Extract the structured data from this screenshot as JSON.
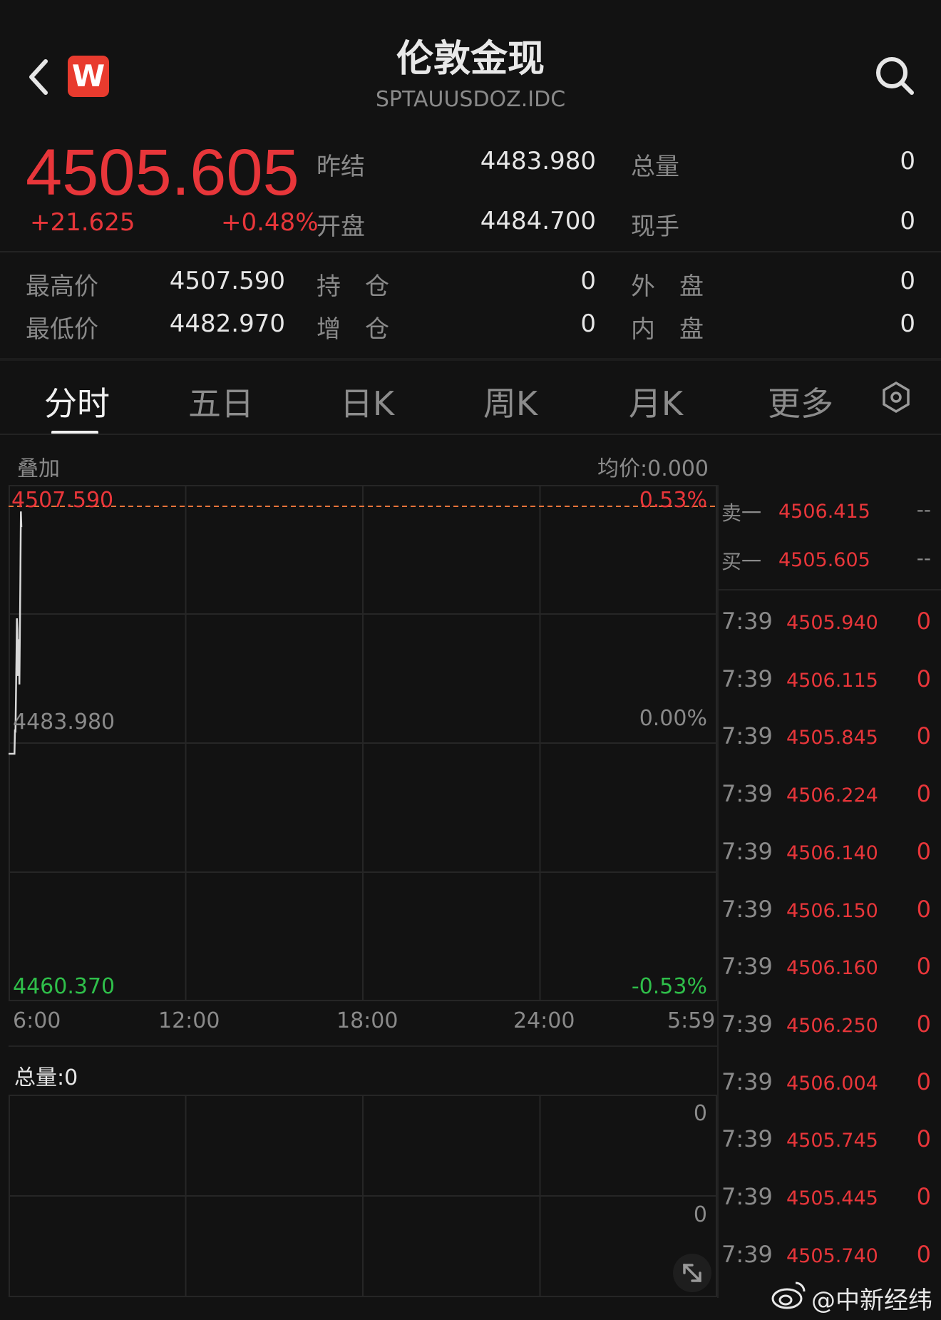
{
  "header": {
    "title": "伦敦金现",
    "code": "SPTAUUSDOZ.IDC",
    "logo_letter": "W",
    "back_icon": "chevron-left-icon",
    "search_icon": "search-icon"
  },
  "quote": {
    "last": "4505.605",
    "change": "+21.625",
    "change_pct": "+0.48%",
    "prev_settle_label": "昨结",
    "prev_settle": "4483.980",
    "open_label": "开盘",
    "open": "4484.700",
    "total_vol_label": "总量",
    "total_vol": "0",
    "cur_hand_label": "现手",
    "cur_hand": "0",
    "high_label": "最高价",
    "high": "4507.590",
    "low_label": "最低价",
    "low": "4482.970",
    "oi_label": "持　仓",
    "oi": "0",
    "oi_chg_label": "增　仓",
    "oi_chg": "0",
    "outer_label": "外　盘",
    "outer": "0",
    "inner_label": "内　盘",
    "inner": "0"
  },
  "tabs": [
    "分时",
    "五日",
    "日K",
    "周K",
    "月K",
    "更多"
  ],
  "active_tab": 0,
  "settings_icon": "hexagon-settings-icon",
  "chart_header": {
    "overlay_label": "叠加",
    "avg_label": "均价:0.000"
  },
  "chart_data": {
    "type": "line",
    "y_max_label": "4507.590",
    "y_mid_label": "4483.980",
    "y_min_label": "4460.370",
    "pct_max_label": "0.53%",
    "pct_mid_label": "0.00%",
    "pct_min_label": "-0.53%",
    "x_tick_labels": [
      "6:00",
      "12:00",
      "18:00",
      "24:00",
      "5:59"
    ],
    "ylim": [
      4460.37,
      4507.59
    ],
    "x_minutes_from_start": [
      0,
      12,
      12,
      13,
      14,
      16,
      17,
      18,
      19,
      20,
      21,
      22,
      24,
      25,
      26
    ],
    "y": [
      4483.98,
      4483.98,
      4483.98,
      4486.3,
      4486.0,
      4493.2,
      4496.9,
      4495.8,
      4491.4,
      4494.6,
      4494.9,
      4490.6,
      4501.0,
      4507.1,
      4505.6
    ],
    "reference_line": 4507.59,
    "volume_label": "总量:0",
    "volume_axis_labels": [
      "0",
      "0"
    ]
  },
  "order_book": [
    {
      "label": "卖一",
      "price": "4506.415",
      "vol": "--"
    },
    {
      "label": "买一",
      "price": "4505.605",
      "vol": "--"
    }
  ],
  "trades": [
    {
      "time": "7:39",
      "price": "4505.940",
      "vol": "0"
    },
    {
      "time": "7:39",
      "price": "4506.115",
      "vol": "0"
    },
    {
      "time": "7:39",
      "price": "4505.845",
      "vol": "0"
    },
    {
      "time": "7:39",
      "price": "4506.224",
      "vol": "0"
    },
    {
      "time": "7:39",
      "price": "4506.140",
      "vol": "0"
    },
    {
      "time": "7:39",
      "price": "4506.150",
      "vol": "0"
    },
    {
      "time": "7:39",
      "price": "4506.160",
      "vol": "0"
    },
    {
      "time": "7:39",
      "price": "4506.250",
      "vol": "0"
    },
    {
      "time": "7:39",
      "price": "4506.004",
      "vol": "0"
    },
    {
      "time": "7:39",
      "price": "4505.745",
      "vol": "0"
    },
    {
      "time": "7:39",
      "price": "4505.445",
      "vol": "0"
    },
    {
      "time": "7:39",
      "price": "4505.740",
      "vol": "0"
    }
  ],
  "expand_icon": "expand-arrows-icon",
  "watermark": "@中新经纬",
  "watermark_icon": "weibo-logo-icon"
}
